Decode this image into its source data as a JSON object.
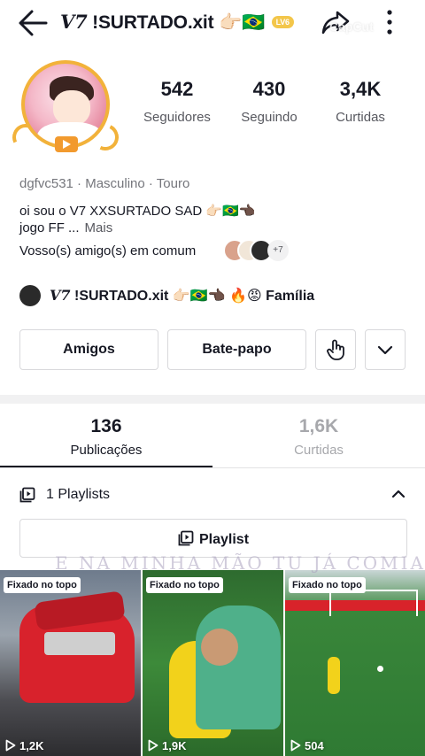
{
  "header": {
    "title_prefix": "V7",
    "title_name": "!SURTADO.xit",
    "title_emoji": "👉🏻🇧🇷",
    "level_badge": "LV6",
    "watermark_overlay": "CapCut"
  },
  "stats": {
    "followers": {
      "value": "542",
      "label": "Seguidores"
    },
    "following": {
      "value": "430",
      "label": "Seguindo"
    },
    "likes": {
      "value": "3,4K",
      "label": "Curtidas"
    }
  },
  "profile": {
    "meta": "dgfvc531 · Masculino · Touro",
    "bio_line1": "oi sou o V7  XXSURTADO SAD 👉🏻🇧🇷👈🏿",
    "bio_line2": "jogo FF ...",
    "bio_more": "Mais",
    "mutual_friends_label": "Vosso(s) amigo(s) em comum",
    "mutual_more": "+7"
  },
  "group": {
    "prefix": "V7",
    "name": "!SURTADO.xit 👉🏻🇧🇷👈🏿 🔥😡 Família"
  },
  "actions": {
    "friends_label": "Amigos",
    "chat_label": "Bate-papo"
  },
  "tabs": [
    {
      "count": "136",
      "label": "Publicações",
      "active": true
    },
    {
      "count": "1,6K",
      "label": "Curtidas",
      "active": false
    }
  ],
  "playlists": {
    "header_label": "1 Playlists",
    "button_label": "Playlist"
  },
  "overlay_text": "E NA MINHA MÃO TU JÁ COMIA",
  "videos": [
    {
      "pin_label": "Fixado no topo",
      "views": "1,2K"
    },
    {
      "pin_label": "Fixado no topo",
      "views": "1,9K"
    },
    {
      "pin_label": "Fixado no topo",
      "views": "504"
    }
  ],
  "colors": {
    "text": "#161823",
    "muted": "#75767c",
    "border": "#d9d9dc",
    "avatar_frame": "#f2b23a"
  }
}
